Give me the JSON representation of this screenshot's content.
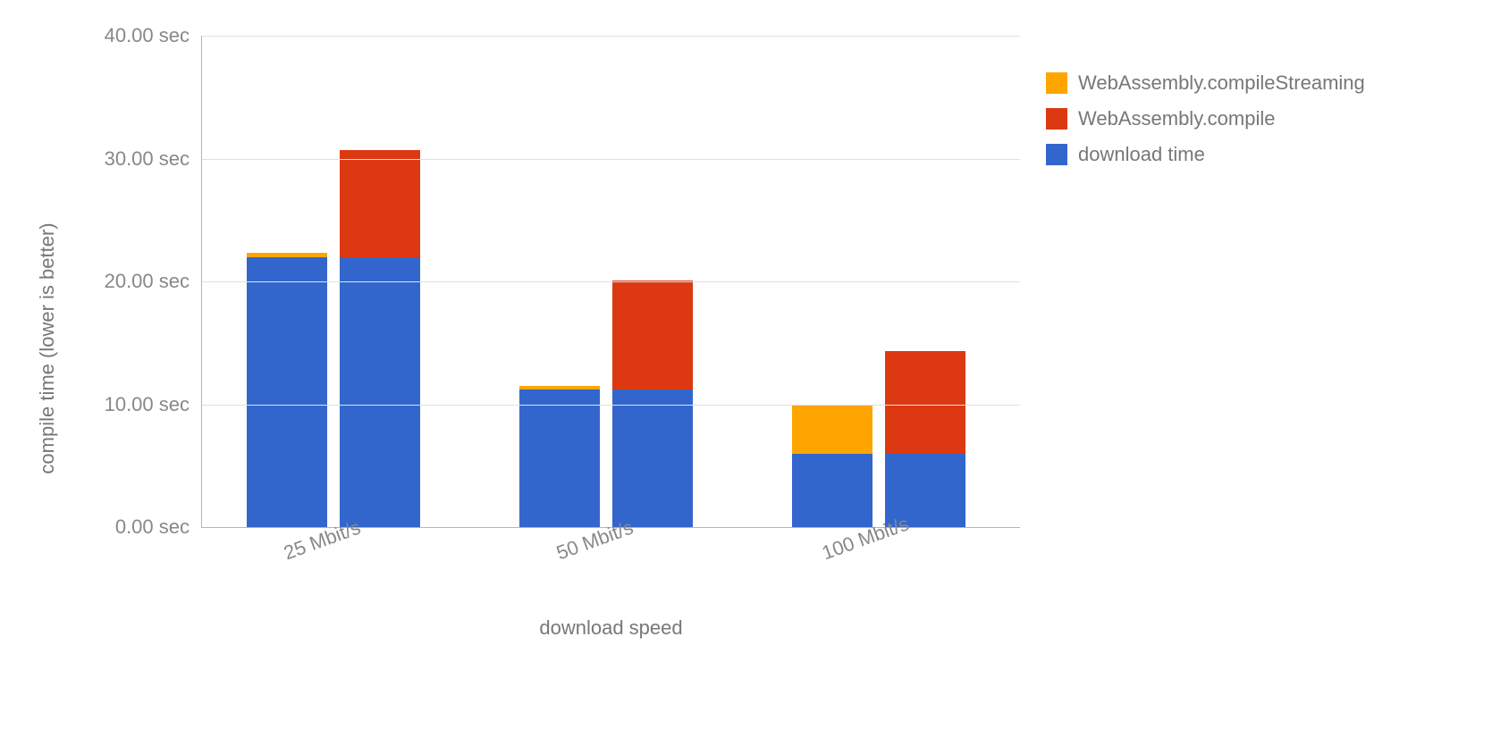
{
  "chart_data": {
    "type": "bar",
    "stacked": true,
    "grouped": true,
    "xlabel": "download speed",
    "ylabel": "compile time (lower is better)",
    "ylim": [
      0,
      40
    ],
    "y_ticks": [
      0,
      10,
      20,
      30,
      40
    ],
    "y_tick_labels": [
      "0.00 sec",
      "10.00 sec",
      "20.00 sec",
      "30.00 sec",
      "40.00 sec"
    ],
    "categories": [
      "25 Mbit/s",
      "50 Mbit/s",
      "100 Mbit/s"
    ],
    "series": [
      {
        "name": "WebAssembly.compileStreaming",
        "color": "#ffa500"
      },
      {
        "name": "WebAssembly.compile",
        "color": "#dc3912"
      },
      {
        "name": "download time",
        "color": "#3366cc"
      }
    ],
    "groups": [
      {
        "category": "25 Mbit/s",
        "bars": [
          {
            "segments": {
              "download time": 22.0,
              "WebAssembly.compileStreaming": 0.3
            },
            "total": 22.3
          },
          {
            "segments": {
              "download time": 22.0,
              "WebAssembly.compile": 8.7
            },
            "total": 30.7
          }
        ]
      },
      {
        "category": "50 Mbit/s",
        "bars": [
          {
            "segments": {
              "download time": 11.2,
              "WebAssembly.compileStreaming": 0.3
            },
            "total": 11.5
          },
          {
            "segments": {
              "download time": 11.2,
              "WebAssembly.compile": 8.9
            },
            "total": 20.1
          }
        ]
      },
      {
        "category": "100 Mbit/s",
        "bars": [
          {
            "segments": {
              "download time": 6.0,
              "WebAssembly.compileStreaming": 4.0
            },
            "total": 10.0
          },
          {
            "segments": {
              "download time": 6.0,
              "WebAssembly.compile": 8.3
            },
            "total": 14.3
          }
        ]
      }
    ]
  },
  "legend": {
    "items": [
      "WebAssembly.compileStreaming",
      "WebAssembly.compile",
      "download time"
    ]
  }
}
